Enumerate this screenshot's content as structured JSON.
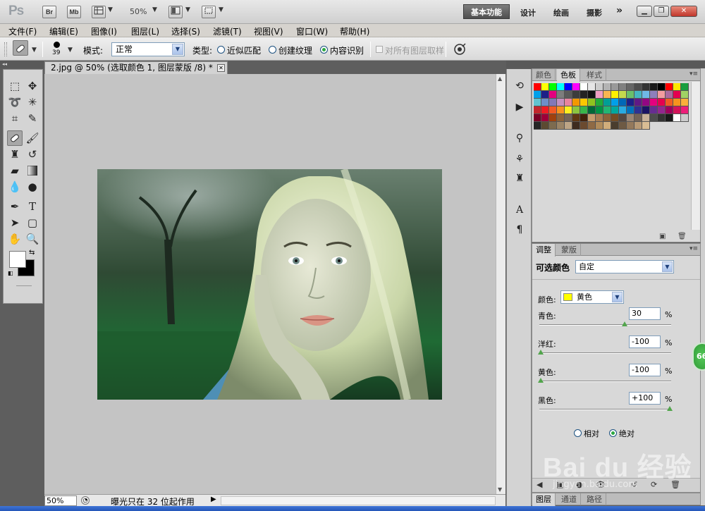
{
  "app": {
    "logo": "Ps",
    "launch_buttons": [
      "Br",
      "Mb"
    ],
    "zoom_level": "50%",
    "workspaces": [
      "基本功能",
      "设计",
      "绘画",
      "摄影"
    ],
    "active_workspace": "基本功能",
    "more": "»"
  },
  "menu": [
    "文件(F)",
    "编辑(E)",
    "图像(I)",
    "图层(L)",
    "选择(S)",
    "滤镜(T)",
    "视图(V)",
    "窗口(W)",
    "帮助(H)"
  ],
  "options": {
    "brush_size": "39",
    "mode_label": "模式:",
    "mode_value": "正常",
    "type_label": "类型:",
    "type_options": [
      "近似匹配",
      "创建纹理",
      "内容识别"
    ],
    "type_selected": "内容识别",
    "sample_all_layers": "对所有图层取样"
  },
  "document": {
    "tab_title": "2.jpg @ 50% (选取颜色 1, 图层蒙版 /8) *",
    "zoom": "50%",
    "status": "曝光只在 32 位起作用"
  },
  "swatch_panel": {
    "tabs": [
      "颜色",
      "色板",
      "样式"
    ],
    "active_tab": "色板",
    "swatches": [
      "#ff0000",
      "#ffff00",
      "#00ff00",
      "#00ffff",
      "#0000ff",
      "#ff00ff",
      "#ffffff",
      "#e6e6e6",
      "#cccccc",
      "#b3b3b3",
      "#999999",
      "#808080",
      "#666666",
      "#4d4d4d",
      "#333333",
      "#1a1a1a",
      "#000000",
      "#ff0000",
      "#ffe600",
      "#1a9e3f",
      "#00a0e9",
      "#1d2088",
      "#e4007f",
      "#7d7d7d",
      "#5a5a5a",
      "#3c3c3c",
      "#232323",
      "#111111",
      "#f19ec2",
      "#f8b551",
      "#fff100",
      "#c3d94e",
      "#6abf6a",
      "#46b5c1",
      "#6fb8e7",
      "#8e7fbb",
      "#f29c9f",
      "#ac6a9f",
      "#e5004f",
      "#a0d264",
      "#61c3cf",
      "#6d8fc8",
      "#8278b6",
      "#c490bf",
      "#e8849f",
      "#f39800",
      "#fcc800",
      "#8fc31f",
      "#22ac38",
      "#009e96",
      "#00a0e9",
      "#0068b7",
      "#1d2088",
      "#601986",
      "#920783",
      "#e4007f",
      "#e5004f",
      "#f15a24",
      "#f7931e",
      "#fbb03b",
      "#c1272d",
      "#ed1c24",
      "#f15a24",
      "#f7931e",
      "#fcee21",
      "#8cc63f",
      "#39b54a",
      "#006837",
      "#009245",
      "#22b573",
      "#00a99d",
      "#29abe2",
      "#0071bc",
      "#2e3192",
      "#1b1464",
      "#662d91",
      "#93278f",
      "#9e005d",
      "#d4145a",
      "#ed1e79",
      "#7a0026",
      "#9e0039",
      "#a0410d",
      "#8c6239",
      "#736357",
      "#603813",
      "#42210b",
      "#c69c6d",
      "#a67c52",
      "#8c6239",
      "#754c24",
      "#534741",
      "#998675",
      "#736357",
      "#c7b299",
      "#4d4d4d",
      "#333333",
      "#1a1a1a",
      "#ffffff",
      "#cccccc",
      "#262626",
      "#5c4a32",
      "#7d6b4f",
      "#9a8466",
      "#bda586",
      "#3d2b1f",
      "#6b4a2f",
      "#8f6a45",
      "#b08b5b",
      "#d1ad7b",
      "#4a3d2e",
      "#6e5a44",
      "#94795c",
      "#b89a76",
      "#d9bd94"
    ],
    "footer": [
      "new-swatch-icon",
      "delete-icon"
    ]
  },
  "adjustments": {
    "tabs": [
      "调整",
      "蒙版"
    ],
    "active_tab": "调整",
    "title": "可选颜色",
    "preset": "自定",
    "color_label": "颜色:",
    "color_value": "黄色",
    "color_hex": "#ffff00",
    "sliders": [
      {
        "label": "青色:",
        "value": "30",
        "pct": 0.65
      },
      {
        "label": "洋红:",
        "value": "-100",
        "pct": 0.0
      },
      {
        "label": "黄色:",
        "value": "-100",
        "pct": 0.0
      },
      {
        "label": "黑色:",
        "value": "+100",
        "pct": 1.0
      }
    ],
    "percent_sign": "%",
    "modes": [
      "相对",
      "绝对"
    ],
    "selected_mode": "绝对"
  },
  "layers_tabs": [
    "图层",
    "通道",
    "路径"
  ],
  "badge": "66",
  "watermark": {
    "text": "Bai du 经验",
    "url": "jingyan.baidu.com"
  }
}
